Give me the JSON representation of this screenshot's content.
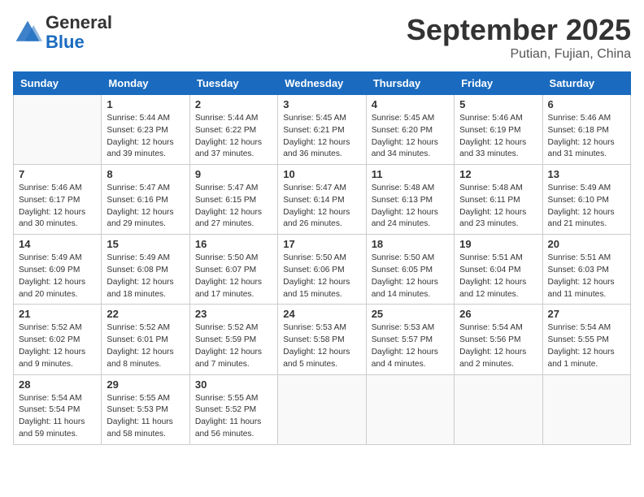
{
  "header": {
    "logo_general": "General",
    "logo_blue": "Blue",
    "month_title": "September 2025",
    "subtitle": "Putian, Fujian, China"
  },
  "weekdays": [
    "Sunday",
    "Monday",
    "Tuesday",
    "Wednesday",
    "Thursday",
    "Friday",
    "Saturday"
  ],
  "weeks": [
    [
      {
        "day": "",
        "info": ""
      },
      {
        "day": "1",
        "info": "Sunrise: 5:44 AM\nSunset: 6:23 PM\nDaylight: 12 hours\nand 39 minutes."
      },
      {
        "day": "2",
        "info": "Sunrise: 5:44 AM\nSunset: 6:22 PM\nDaylight: 12 hours\nand 37 minutes."
      },
      {
        "day": "3",
        "info": "Sunrise: 5:45 AM\nSunset: 6:21 PM\nDaylight: 12 hours\nand 36 minutes."
      },
      {
        "day": "4",
        "info": "Sunrise: 5:45 AM\nSunset: 6:20 PM\nDaylight: 12 hours\nand 34 minutes."
      },
      {
        "day": "5",
        "info": "Sunrise: 5:46 AM\nSunset: 6:19 PM\nDaylight: 12 hours\nand 33 minutes."
      },
      {
        "day": "6",
        "info": "Sunrise: 5:46 AM\nSunset: 6:18 PM\nDaylight: 12 hours\nand 31 minutes."
      }
    ],
    [
      {
        "day": "7",
        "info": "Sunrise: 5:46 AM\nSunset: 6:17 PM\nDaylight: 12 hours\nand 30 minutes."
      },
      {
        "day": "8",
        "info": "Sunrise: 5:47 AM\nSunset: 6:16 PM\nDaylight: 12 hours\nand 29 minutes."
      },
      {
        "day": "9",
        "info": "Sunrise: 5:47 AM\nSunset: 6:15 PM\nDaylight: 12 hours\nand 27 minutes."
      },
      {
        "day": "10",
        "info": "Sunrise: 5:47 AM\nSunset: 6:14 PM\nDaylight: 12 hours\nand 26 minutes."
      },
      {
        "day": "11",
        "info": "Sunrise: 5:48 AM\nSunset: 6:13 PM\nDaylight: 12 hours\nand 24 minutes."
      },
      {
        "day": "12",
        "info": "Sunrise: 5:48 AM\nSunset: 6:11 PM\nDaylight: 12 hours\nand 23 minutes."
      },
      {
        "day": "13",
        "info": "Sunrise: 5:49 AM\nSunset: 6:10 PM\nDaylight: 12 hours\nand 21 minutes."
      }
    ],
    [
      {
        "day": "14",
        "info": "Sunrise: 5:49 AM\nSunset: 6:09 PM\nDaylight: 12 hours\nand 20 minutes."
      },
      {
        "day": "15",
        "info": "Sunrise: 5:49 AM\nSunset: 6:08 PM\nDaylight: 12 hours\nand 18 minutes."
      },
      {
        "day": "16",
        "info": "Sunrise: 5:50 AM\nSunset: 6:07 PM\nDaylight: 12 hours\nand 17 minutes."
      },
      {
        "day": "17",
        "info": "Sunrise: 5:50 AM\nSunset: 6:06 PM\nDaylight: 12 hours\nand 15 minutes."
      },
      {
        "day": "18",
        "info": "Sunrise: 5:50 AM\nSunset: 6:05 PM\nDaylight: 12 hours\nand 14 minutes."
      },
      {
        "day": "19",
        "info": "Sunrise: 5:51 AM\nSunset: 6:04 PM\nDaylight: 12 hours\nand 12 minutes."
      },
      {
        "day": "20",
        "info": "Sunrise: 5:51 AM\nSunset: 6:03 PM\nDaylight: 12 hours\nand 11 minutes."
      }
    ],
    [
      {
        "day": "21",
        "info": "Sunrise: 5:52 AM\nSunset: 6:02 PM\nDaylight: 12 hours\nand 9 minutes."
      },
      {
        "day": "22",
        "info": "Sunrise: 5:52 AM\nSunset: 6:01 PM\nDaylight: 12 hours\nand 8 minutes."
      },
      {
        "day": "23",
        "info": "Sunrise: 5:52 AM\nSunset: 5:59 PM\nDaylight: 12 hours\nand 7 minutes."
      },
      {
        "day": "24",
        "info": "Sunrise: 5:53 AM\nSunset: 5:58 PM\nDaylight: 12 hours\nand 5 minutes."
      },
      {
        "day": "25",
        "info": "Sunrise: 5:53 AM\nSunset: 5:57 PM\nDaylight: 12 hours\nand 4 minutes."
      },
      {
        "day": "26",
        "info": "Sunrise: 5:54 AM\nSunset: 5:56 PM\nDaylight: 12 hours\nand 2 minutes."
      },
      {
        "day": "27",
        "info": "Sunrise: 5:54 AM\nSunset: 5:55 PM\nDaylight: 12 hours\nand 1 minute."
      }
    ],
    [
      {
        "day": "28",
        "info": "Sunrise: 5:54 AM\nSunset: 5:54 PM\nDaylight: 11 hours\nand 59 minutes."
      },
      {
        "day": "29",
        "info": "Sunrise: 5:55 AM\nSunset: 5:53 PM\nDaylight: 11 hours\nand 58 minutes."
      },
      {
        "day": "30",
        "info": "Sunrise: 5:55 AM\nSunset: 5:52 PM\nDaylight: 11 hours\nand 56 minutes."
      },
      {
        "day": "",
        "info": ""
      },
      {
        "day": "",
        "info": ""
      },
      {
        "day": "",
        "info": ""
      },
      {
        "day": "",
        "info": ""
      }
    ]
  ]
}
